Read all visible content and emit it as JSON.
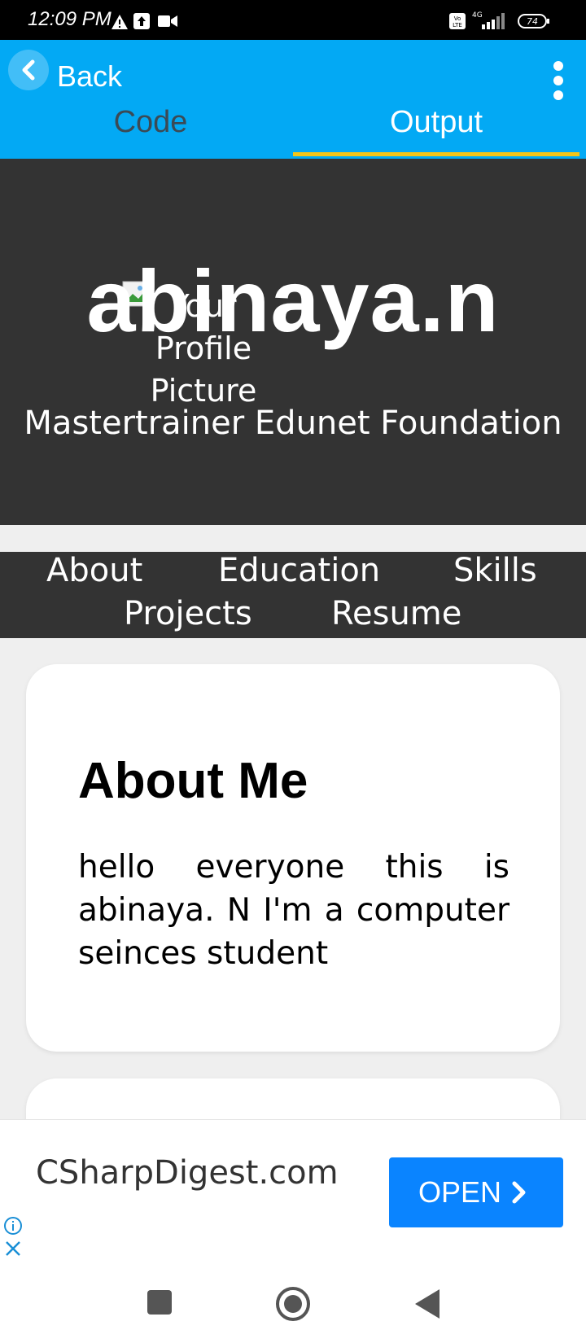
{
  "status_bar": {
    "time": "12:09 PM",
    "signal_label": "4G",
    "volte_label": "Vo LTE",
    "battery": "74"
  },
  "app_bar": {
    "back_label": "Back",
    "tabs": [
      {
        "label": "Code",
        "active": false
      },
      {
        "label": "Output",
        "active": true
      }
    ],
    "accent_color": "#03a9f4",
    "indicator_color": "#f5c518"
  },
  "hero": {
    "name": "abinaya.n",
    "image_alt_lines": [
      "Your",
      "Profile",
      "Picture"
    ],
    "subtitle": "Mastertrainer Edunet Foundation"
  },
  "nav": {
    "items": [
      "About",
      "Education",
      "Skills",
      "Projects",
      "Resume"
    ]
  },
  "about": {
    "title": "About Me",
    "body": "hello everyone this is abinaya. N I'm a computer seinces student"
  },
  "ad": {
    "site": "CSharpDigest.com",
    "button": "OPEN",
    "button_color": "#0a84ff"
  }
}
